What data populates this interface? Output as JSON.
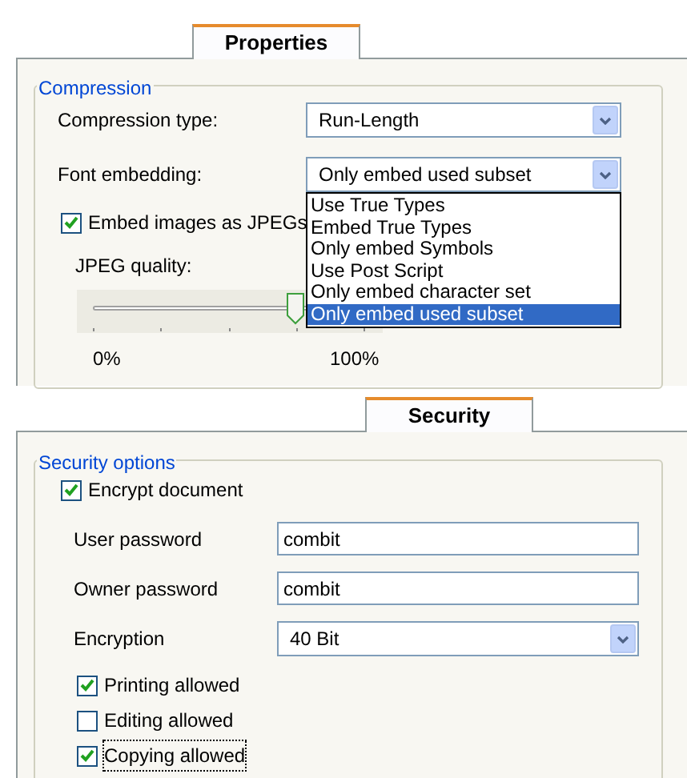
{
  "properties_panel": {
    "tab": {
      "label": "Properties",
      "selected": true
    },
    "group_title": "Compression",
    "compression_type": {
      "label": "Compression type:",
      "value": "Run-Length"
    },
    "font_embedding": {
      "label": "Font embedding:",
      "value": "Only embed used subset",
      "expanded": true,
      "options": [
        {
          "label": "Use True Types",
          "selected": false
        },
        {
          "label": "Embed True Types",
          "selected": false
        },
        {
          "label": "Only embed Symbols",
          "selected": false
        },
        {
          "label": "Use Post Script",
          "selected": false
        },
        {
          "label": "Only embed character set",
          "selected": false
        },
        {
          "label": "Only embed used subset",
          "selected": true
        }
      ]
    },
    "embed_jpeg": {
      "label": "Embed images as JPEGs",
      "checked": true
    },
    "jpeg_quality": {
      "label": "JPEG quality:",
      "level": 0.75,
      "min_label": "0%",
      "max_label": "100%"
    }
  },
  "security_panel": {
    "tab": {
      "label": "Security",
      "selected": true
    },
    "group_title": "Security options",
    "encrypt": {
      "label": "Encrypt document",
      "checked": true
    },
    "fields": [
      {
        "label": "User password",
        "value": "combit"
      },
      {
        "label": "Owner password",
        "value": "combit"
      }
    ],
    "encryption": {
      "label": "Encryption",
      "value": "40 Bit"
    },
    "permissions": [
      {
        "label": "Printing allowed",
        "checked": true,
        "focused": false
      },
      {
        "label": "Editing allowed",
        "checked": false,
        "focused": false
      },
      {
        "label": "Copying allowed",
        "checked": true,
        "focused": true
      }
    ]
  }
}
